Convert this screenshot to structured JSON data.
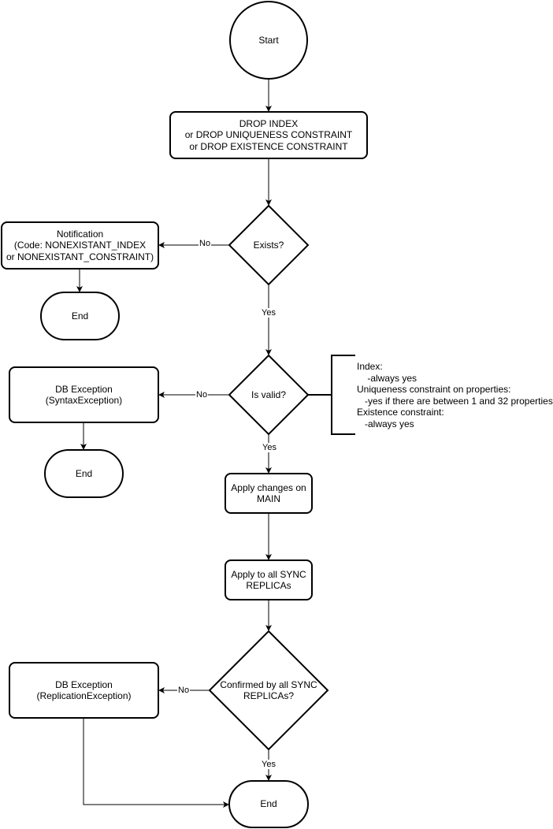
{
  "diagram": {
    "nodes": {
      "start": "Start",
      "drop_cmd": "DROP INDEX\nor DROP UNIQUENESS CONSTRAINT\nor DROP EXISTENCE CONSTRAINT",
      "exists": "Exists?",
      "notification": "Notification\n(Code: NONEXISTANT_INDEX\nor NONEXISTANT_CONSTRAINT)",
      "end1": "End",
      "is_valid": "Is valid?",
      "syntax_exc": "DB Exception\n(SyntaxException)",
      "end2": "End",
      "apply_main": "Apply changes on\nMAIN",
      "apply_sync": "Apply to all SYNC\nREPLICAs",
      "confirmed": "Confirmed by all SYNC\nREPLICAs?",
      "repl_exc": "DB Exception\n(ReplicationException)",
      "end3": "End"
    },
    "edge_labels": {
      "exists_no": "No",
      "exists_yes": "Yes",
      "valid_no": "No",
      "valid_yes": "Yes",
      "confirmed_no": "No",
      "confirmed_yes": "Yes"
    },
    "annotation": "Index:\n    -always yes\nUniqueness constraint on properties:\n   -yes if there are between 1 and 32 properties\nExistence constraint:\n   -always yes"
  }
}
